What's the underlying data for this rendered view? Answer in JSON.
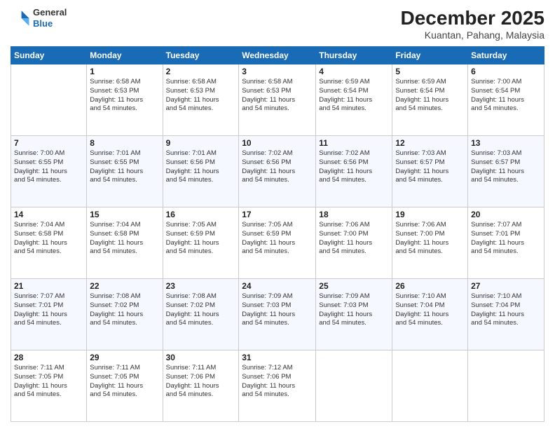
{
  "header": {
    "logo": {
      "general": "General",
      "blue": "Blue"
    },
    "title": "December 2025",
    "location": "Kuantan, Pahang, Malaysia"
  },
  "columns": [
    "Sunday",
    "Monday",
    "Tuesday",
    "Wednesday",
    "Thursday",
    "Friday",
    "Saturday"
  ],
  "weeks": [
    [
      {
        "day": "",
        "info": ""
      },
      {
        "day": "1",
        "info": "Sunrise: 6:58 AM\nSunset: 6:53 PM\nDaylight: 11 hours\nand 54 minutes."
      },
      {
        "day": "2",
        "info": "Sunrise: 6:58 AM\nSunset: 6:53 PM\nDaylight: 11 hours\nand 54 minutes."
      },
      {
        "day": "3",
        "info": "Sunrise: 6:58 AM\nSunset: 6:53 PM\nDaylight: 11 hours\nand 54 minutes."
      },
      {
        "day": "4",
        "info": "Sunrise: 6:59 AM\nSunset: 6:54 PM\nDaylight: 11 hours\nand 54 minutes."
      },
      {
        "day": "5",
        "info": "Sunrise: 6:59 AM\nSunset: 6:54 PM\nDaylight: 11 hours\nand 54 minutes."
      },
      {
        "day": "6",
        "info": "Sunrise: 7:00 AM\nSunset: 6:54 PM\nDaylight: 11 hours\nand 54 minutes."
      }
    ],
    [
      {
        "day": "7",
        "info": "Sunrise: 7:00 AM\nSunset: 6:55 PM\nDaylight: 11 hours\nand 54 minutes."
      },
      {
        "day": "8",
        "info": "Sunrise: 7:01 AM\nSunset: 6:55 PM\nDaylight: 11 hours\nand 54 minutes."
      },
      {
        "day": "9",
        "info": "Sunrise: 7:01 AM\nSunset: 6:56 PM\nDaylight: 11 hours\nand 54 minutes."
      },
      {
        "day": "10",
        "info": "Sunrise: 7:02 AM\nSunset: 6:56 PM\nDaylight: 11 hours\nand 54 minutes."
      },
      {
        "day": "11",
        "info": "Sunrise: 7:02 AM\nSunset: 6:56 PM\nDaylight: 11 hours\nand 54 minutes."
      },
      {
        "day": "12",
        "info": "Sunrise: 7:03 AM\nSunset: 6:57 PM\nDaylight: 11 hours\nand 54 minutes."
      },
      {
        "day": "13",
        "info": "Sunrise: 7:03 AM\nSunset: 6:57 PM\nDaylight: 11 hours\nand 54 minutes."
      }
    ],
    [
      {
        "day": "14",
        "info": "Sunrise: 7:04 AM\nSunset: 6:58 PM\nDaylight: 11 hours\nand 54 minutes."
      },
      {
        "day": "15",
        "info": "Sunrise: 7:04 AM\nSunset: 6:58 PM\nDaylight: 11 hours\nand 54 minutes."
      },
      {
        "day": "16",
        "info": "Sunrise: 7:05 AM\nSunset: 6:59 PM\nDaylight: 11 hours\nand 54 minutes."
      },
      {
        "day": "17",
        "info": "Sunrise: 7:05 AM\nSunset: 6:59 PM\nDaylight: 11 hours\nand 54 minutes."
      },
      {
        "day": "18",
        "info": "Sunrise: 7:06 AM\nSunset: 7:00 PM\nDaylight: 11 hours\nand 54 minutes."
      },
      {
        "day": "19",
        "info": "Sunrise: 7:06 AM\nSunset: 7:00 PM\nDaylight: 11 hours\nand 54 minutes."
      },
      {
        "day": "20",
        "info": "Sunrise: 7:07 AM\nSunset: 7:01 PM\nDaylight: 11 hours\nand 54 minutes."
      }
    ],
    [
      {
        "day": "21",
        "info": "Sunrise: 7:07 AM\nSunset: 7:01 PM\nDaylight: 11 hours\nand 54 minutes."
      },
      {
        "day": "22",
        "info": "Sunrise: 7:08 AM\nSunset: 7:02 PM\nDaylight: 11 hours\nand 54 minutes."
      },
      {
        "day": "23",
        "info": "Sunrise: 7:08 AM\nSunset: 7:02 PM\nDaylight: 11 hours\nand 54 minutes."
      },
      {
        "day": "24",
        "info": "Sunrise: 7:09 AM\nSunset: 7:03 PM\nDaylight: 11 hours\nand 54 minutes."
      },
      {
        "day": "25",
        "info": "Sunrise: 7:09 AM\nSunset: 7:03 PM\nDaylight: 11 hours\nand 54 minutes."
      },
      {
        "day": "26",
        "info": "Sunrise: 7:10 AM\nSunset: 7:04 PM\nDaylight: 11 hours\nand 54 minutes."
      },
      {
        "day": "27",
        "info": "Sunrise: 7:10 AM\nSunset: 7:04 PM\nDaylight: 11 hours\nand 54 minutes."
      }
    ],
    [
      {
        "day": "28",
        "info": "Sunrise: 7:11 AM\nSunset: 7:05 PM\nDaylight: 11 hours\nand 54 minutes."
      },
      {
        "day": "29",
        "info": "Sunrise: 7:11 AM\nSunset: 7:05 PM\nDaylight: 11 hours\nand 54 minutes."
      },
      {
        "day": "30",
        "info": "Sunrise: 7:11 AM\nSunset: 7:06 PM\nDaylight: 11 hours\nand 54 minutes."
      },
      {
        "day": "31",
        "info": "Sunrise: 7:12 AM\nSunset: 7:06 PM\nDaylight: 11 hours\nand 54 minutes."
      },
      {
        "day": "",
        "info": ""
      },
      {
        "day": "",
        "info": ""
      },
      {
        "day": "",
        "info": ""
      }
    ]
  ]
}
